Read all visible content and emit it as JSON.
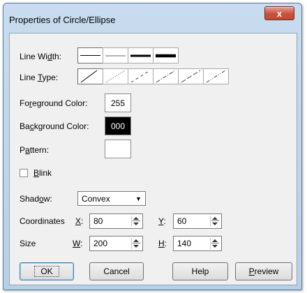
{
  "window": {
    "title": "Properties of Circle/Ellipse",
    "close_label": "x"
  },
  "line_width": {
    "label_pre": "Line Wi",
    "label_mn": "d",
    "label_post": "th:",
    "options": [
      "thin",
      "thin-gray",
      "medium",
      "thick"
    ],
    "selected": 0
  },
  "line_type": {
    "label_pre": "Line ",
    "label_mn": "T",
    "label_post": "ype:",
    "options": [
      "solid",
      "dotted",
      "dash",
      "dash-dot",
      "long-dash",
      "dash-dot-dot"
    ],
    "selected": 0
  },
  "foreground": {
    "label_pre": "Fo",
    "label_mn": "r",
    "label_post": "eground Color:",
    "value": "255",
    "color": "#ffffff"
  },
  "background": {
    "label_pre": "Ba",
    "label_mn": "c",
    "label_post": "kground Color:",
    "value": "000",
    "color": "#000000"
  },
  "pattern": {
    "label_pre": "P",
    "label_mn": "a",
    "label_post": "ttern:"
  },
  "blink": {
    "label_mn": "B",
    "label_post": "link",
    "checked": false
  },
  "shadow": {
    "label_pre": "Shad",
    "label_mn": "o",
    "label_post": "w:",
    "value": "Convex"
  },
  "coordinates": {
    "label": "Coordinates",
    "x_label_mn": "X",
    "x_label_post": ":",
    "x_value": "80",
    "y_label_mn": "Y",
    "y_label_post": ":",
    "y_value": "60"
  },
  "size": {
    "label": "Size",
    "w_label_mn": "W",
    "w_label_post": ":",
    "w_value": "200",
    "h_label_mn": "H",
    "h_label_post": ":",
    "h_value": "140"
  },
  "buttons": {
    "ok": "OK",
    "cancel": "Cancel",
    "help": "Help",
    "preview_mn": "P",
    "preview_post": "review"
  }
}
